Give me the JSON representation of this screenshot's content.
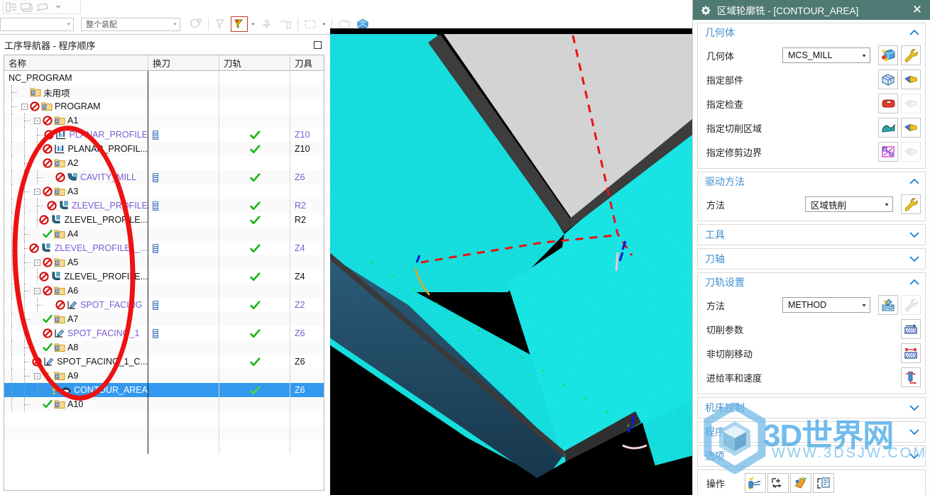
{
  "toolbar": {
    "group1_icons": [
      "list-view-icon",
      "assembly-icon",
      "plane-icon",
      "dropdown-arrow-icon"
    ],
    "combo_left": {
      "value": "",
      "name": "filter-combo"
    },
    "combo_assembly": {
      "value": "整个装配",
      "name": "assembly-scope-combo"
    },
    "icons": [
      "assembly-explode-icon",
      "move-face-filter-icon",
      "move-object-filter-icon",
      "dropdown-arrow-icon",
      "rotate-point-icon",
      "measure-icon",
      "rectangle-select-icon",
      "dropdown-arrow-icon",
      "shaded-view-icon",
      "orient-view-icon"
    ]
  },
  "tree_panel": {
    "title": "工序导航器 - 程序顺序",
    "restore_button": "restore-window-button",
    "columns": [
      "名称",
      "换刀",
      "刀轨",
      "刀具"
    ],
    "rows": [
      {
        "name": "NC_PROGRAM",
        "depth": 0,
        "expander": "",
        "status": "none",
        "type": "none",
        "changer": false,
        "path": false,
        "tool": "",
        "gen": false,
        "selected": false
      },
      {
        "name": "未用项",
        "depth": 1,
        "expander": "",
        "status": "none",
        "type": "folder",
        "changer": false,
        "path": false,
        "tool": "",
        "gen": false,
        "selected": false
      },
      {
        "name": "PROGRAM",
        "depth": 1,
        "expander": "-",
        "status": "blocked",
        "type": "folder",
        "changer": false,
        "path": false,
        "tool": "",
        "gen": false,
        "selected": false
      },
      {
        "name": "A1",
        "depth": 2,
        "expander": "-",
        "status": "blocked",
        "type": "folder",
        "changer": false,
        "path": false,
        "tool": "",
        "gen": false,
        "selected": false
      },
      {
        "name": "PLANAR_PROFILE",
        "depth": 3,
        "expander": "",
        "status": "blocked",
        "type": "planar",
        "changer": true,
        "path": true,
        "tool": "Z10",
        "gen": true,
        "selected": false
      },
      {
        "name": "PLANAR_PROFIL...",
        "depth": 3,
        "expander": "",
        "status": "blocked",
        "type": "planar",
        "changer": false,
        "path": true,
        "tool": "Z10",
        "gen": false,
        "selected": false
      },
      {
        "name": "A2",
        "depth": 2,
        "expander": "",
        "status": "blocked",
        "type": "folder",
        "changer": false,
        "path": false,
        "tool": "",
        "gen": false,
        "selected": false
      },
      {
        "name": "CAVITY_MILL",
        "depth": 3,
        "expander": "",
        "status": "blocked",
        "type": "cavity",
        "changer": true,
        "path": true,
        "tool": "Z6",
        "gen": true,
        "selected": false
      },
      {
        "name": "A3",
        "depth": 2,
        "expander": "-",
        "status": "blocked",
        "type": "folder",
        "changer": false,
        "path": false,
        "tool": "",
        "gen": false,
        "selected": false
      },
      {
        "name": "ZLEVEL_PROFILE",
        "depth": 3,
        "expander": "",
        "status": "blocked",
        "type": "zlevel",
        "changer": true,
        "path": true,
        "tool": "R2",
        "gen": true,
        "selected": false
      },
      {
        "name": "ZLEVEL_PROFILE...",
        "depth": 3,
        "expander": "",
        "status": "blocked",
        "type": "zlevel",
        "changer": false,
        "path": true,
        "tool": "R2",
        "gen": false,
        "selected": false
      },
      {
        "name": "A4",
        "depth": 2,
        "expander": "",
        "status": "ok",
        "type": "folder",
        "changer": false,
        "path": false,
        "tool": "",
        "gen": false,
        "selected": false
      },
      {
        "name": "ZLEVEL_PROFILE__...",
        "depth": 2,
        "expander": "",
        "status": "blocked",
        "type": "zlevel",
        "changer": true,
        "path": true,
        "tool": "Z4",
        "gen": true,
        "selected": false
      },
      {
        "name": "A5",
        "depth": 2,
        "expander": "-",
        "status": "blocked",
        "type": "folder",
        "changer": false,
        "path": false,
        "tool": "",
        "gen": false,
        "selected": false
      },
      {
        "name": "ZLEVEL_PROFILE...",
        "depth": 3,
        "expander": "",
        "status": "blocked",
        "type": "zlevel",
        "changer": false,
        "path": true,
        "tool": "Z4",
        "gen": false,
        "selected": false
      },
      {
        "name": "A6",
        "depth": 2,
        "expander": "-",
        "status": "blocked",
        "type": "folder",
        "changer": false,
        "path": false,
        "tool": "",
        "gen": false,
        "selected": false
      },
      {
        "name": "SPOT_FACING",
        "depth": 3,
        "expander": "",
        "status": "blocked",
        "type": "spot",
        "changer": true,
        "path": true,
        "tool": "Z2",
        "gen": true,
        "selected": false
      },
      {
        "name": "A7",
        "depth": 2,
        "expander": "",
        "status": "ok",
        "type": "folder",
        "changer": false,
        "path": false,
        "tool": "",
        "gen": false,
        "selected": false
      },
      {
        "name": "SPOT_FACING_1",
        "depth": 2,
        "expander": "",
        "status": "blocked",
        "type": "spot",
        "changer": true,
        "path": true,
        "tool": "Z6",
        "gen": true,
        "selected": false
      },
      {
        "name": "A8",
        "depth": 2,
        "expander": "",
        "status": "ok",
        "type": "folder",
        "changer": false,
        "path": false,
        "tool": "",
        "gen": false,
        "selected": false
      },
      {
        "name": "SPOT_FACING_1_C...",
        "depth": 2,
        "expander": "",
        "status": "blocked",
        "type": "spot",
        "changer": false,
        "path": true,
        "tool": "Z6",
        "gen": false,
        "selected": false
      },
      {
        "name": "A9",
        "depth": 2,
        "expander": "-",
        "status": "warn",
        "type": "folder",
        "changer": false,
        "path": false,
        "tool": "",
        "gen": false,
        "selected": false
      },
      {
        "name": "CONTOUR_AREA",
        "depth": 3,
        "expander": "",
        "status": "warn",
        "type": "contour",
        "changer": false,
        "path": true,
        "tool": "Z6",
        "gen": false,
        "selected": true
      },
      {
        "name": "A10",
        "depth": 2,
        "expander": "",
        "status": "ok",
        "type": "folder",
        "changer": false,
        "path": false,
        "tool": "",
        "gen": false,
        "selected": false
      }
    ]
  },
  "annotation": {
    "shape": "red-ellipse-highlight"
  },
  "dialog": {
    "title": "区域轮廓铣 - [CONTOUR_AREA]",
    "title_icon": "gear-icon",
    "close_label": "✕",
    "sections": [
      {
        "title": "几何体",
        "collapsed": false,
        "chevron": "︿",
        "rows": [
          {
            "label": "几何体",
            "select": "MCS_MILL",
            "buttons": [
              "mcs-geometry-icon",
              "wrench-icon"
            ]
          },
          {
            "label": "指定部件",
            "select": null,
            "buttons": [
              "part-body-icon",
              "select-part-icon"
            ]
          },
          {
            "label": "指定检查",
            "select": null,
            "buttons": [
              "check-body-icon",
              "select-check-icon-disabled"
            ]
          },
          {
            "label": "指定切削区域",
            "select": null,
            "buttons": [
              "cut-area-icon",
              "select-cut-area-icon"
            ]
          },
          {
            "label": "指定修剪边界",
            "select": null,
            "buttons": [
              "trim-boundary-icon",
              "select-trim-icon-disabled"
            ]
          }
        ]
      },
      {
        "title": "驱动方法",
        "collapsed": false,
        "chevron": "︿",
        "rows": [
          {
            "label": "方法",
            "select": "区域铣削",
            "buttons": [
              "wrench-icon"
            ]
          }
        ]
      },
      {
        "title": "工具",
        "collapsed": true,
        "chevron": "﹀",
        "rows": []
      },
      {
        "title": "刀轴",
        "collapsed": true,
        "chevron": "﹀",
        "rows": []
      },
      {
        "title": "刀轨设置",
        "collapsed": false,
        "chevron": "︿",
        "rows": [
          {
            "label": "方法",
            "select": "METHOD",
            "buttons": [
              "method-icon",
              "wrench-icon-disabled"
            ]
          },
          {
            "label": "切削参数",
            "select": null,
            "buttons": [
              "cutting-parameters-icon"
            ]
          },
          {
            "label": "非切削移动",
            "select": null,
            "buttons": [
              "non-cutting-moves-icon"
            ]
          },
          {
            "label": "进给率和速度",
            "select": null,
            "buttons": [
              "feeds-speeds-icon"
            ]
          }
        ]
      },
      {
        "title": "机床控制",
        "collapsed": true,
        "chevron": "﹀",
        "rows": []
      },
      {
        "title": "程序",
        "collapsed": true,
        "chevron": "﹀",
        "rows": []
      },
      {
        "title": "选项",
        "collapsed": true,
        "chevron": "﹀",
        "rows": []
      }
    ],
    "operation": {
      "label": "操作",
      "buttons": [
        "generate-icon",
        "replay-icon",
        "verify-icon",
        "list-icon"
      ]
    }
  },
  "watermark": {
    "text": "3D世界网",
    "sub": "WWW.3DSJW.COM",
    "logo": "hexagon-cube-logo"
  },
  "colors": {
    "title_bar": "#4f7a73",
    "selection": "#3399ee",
    "section_title": "#3f8fd0",
    "generated_text": "#7b5cd6",
    "annotation": "#ee1111",
    "watermark": "#49a9e8",
    "viewport_surface": "#16e8e8"
  }
}
